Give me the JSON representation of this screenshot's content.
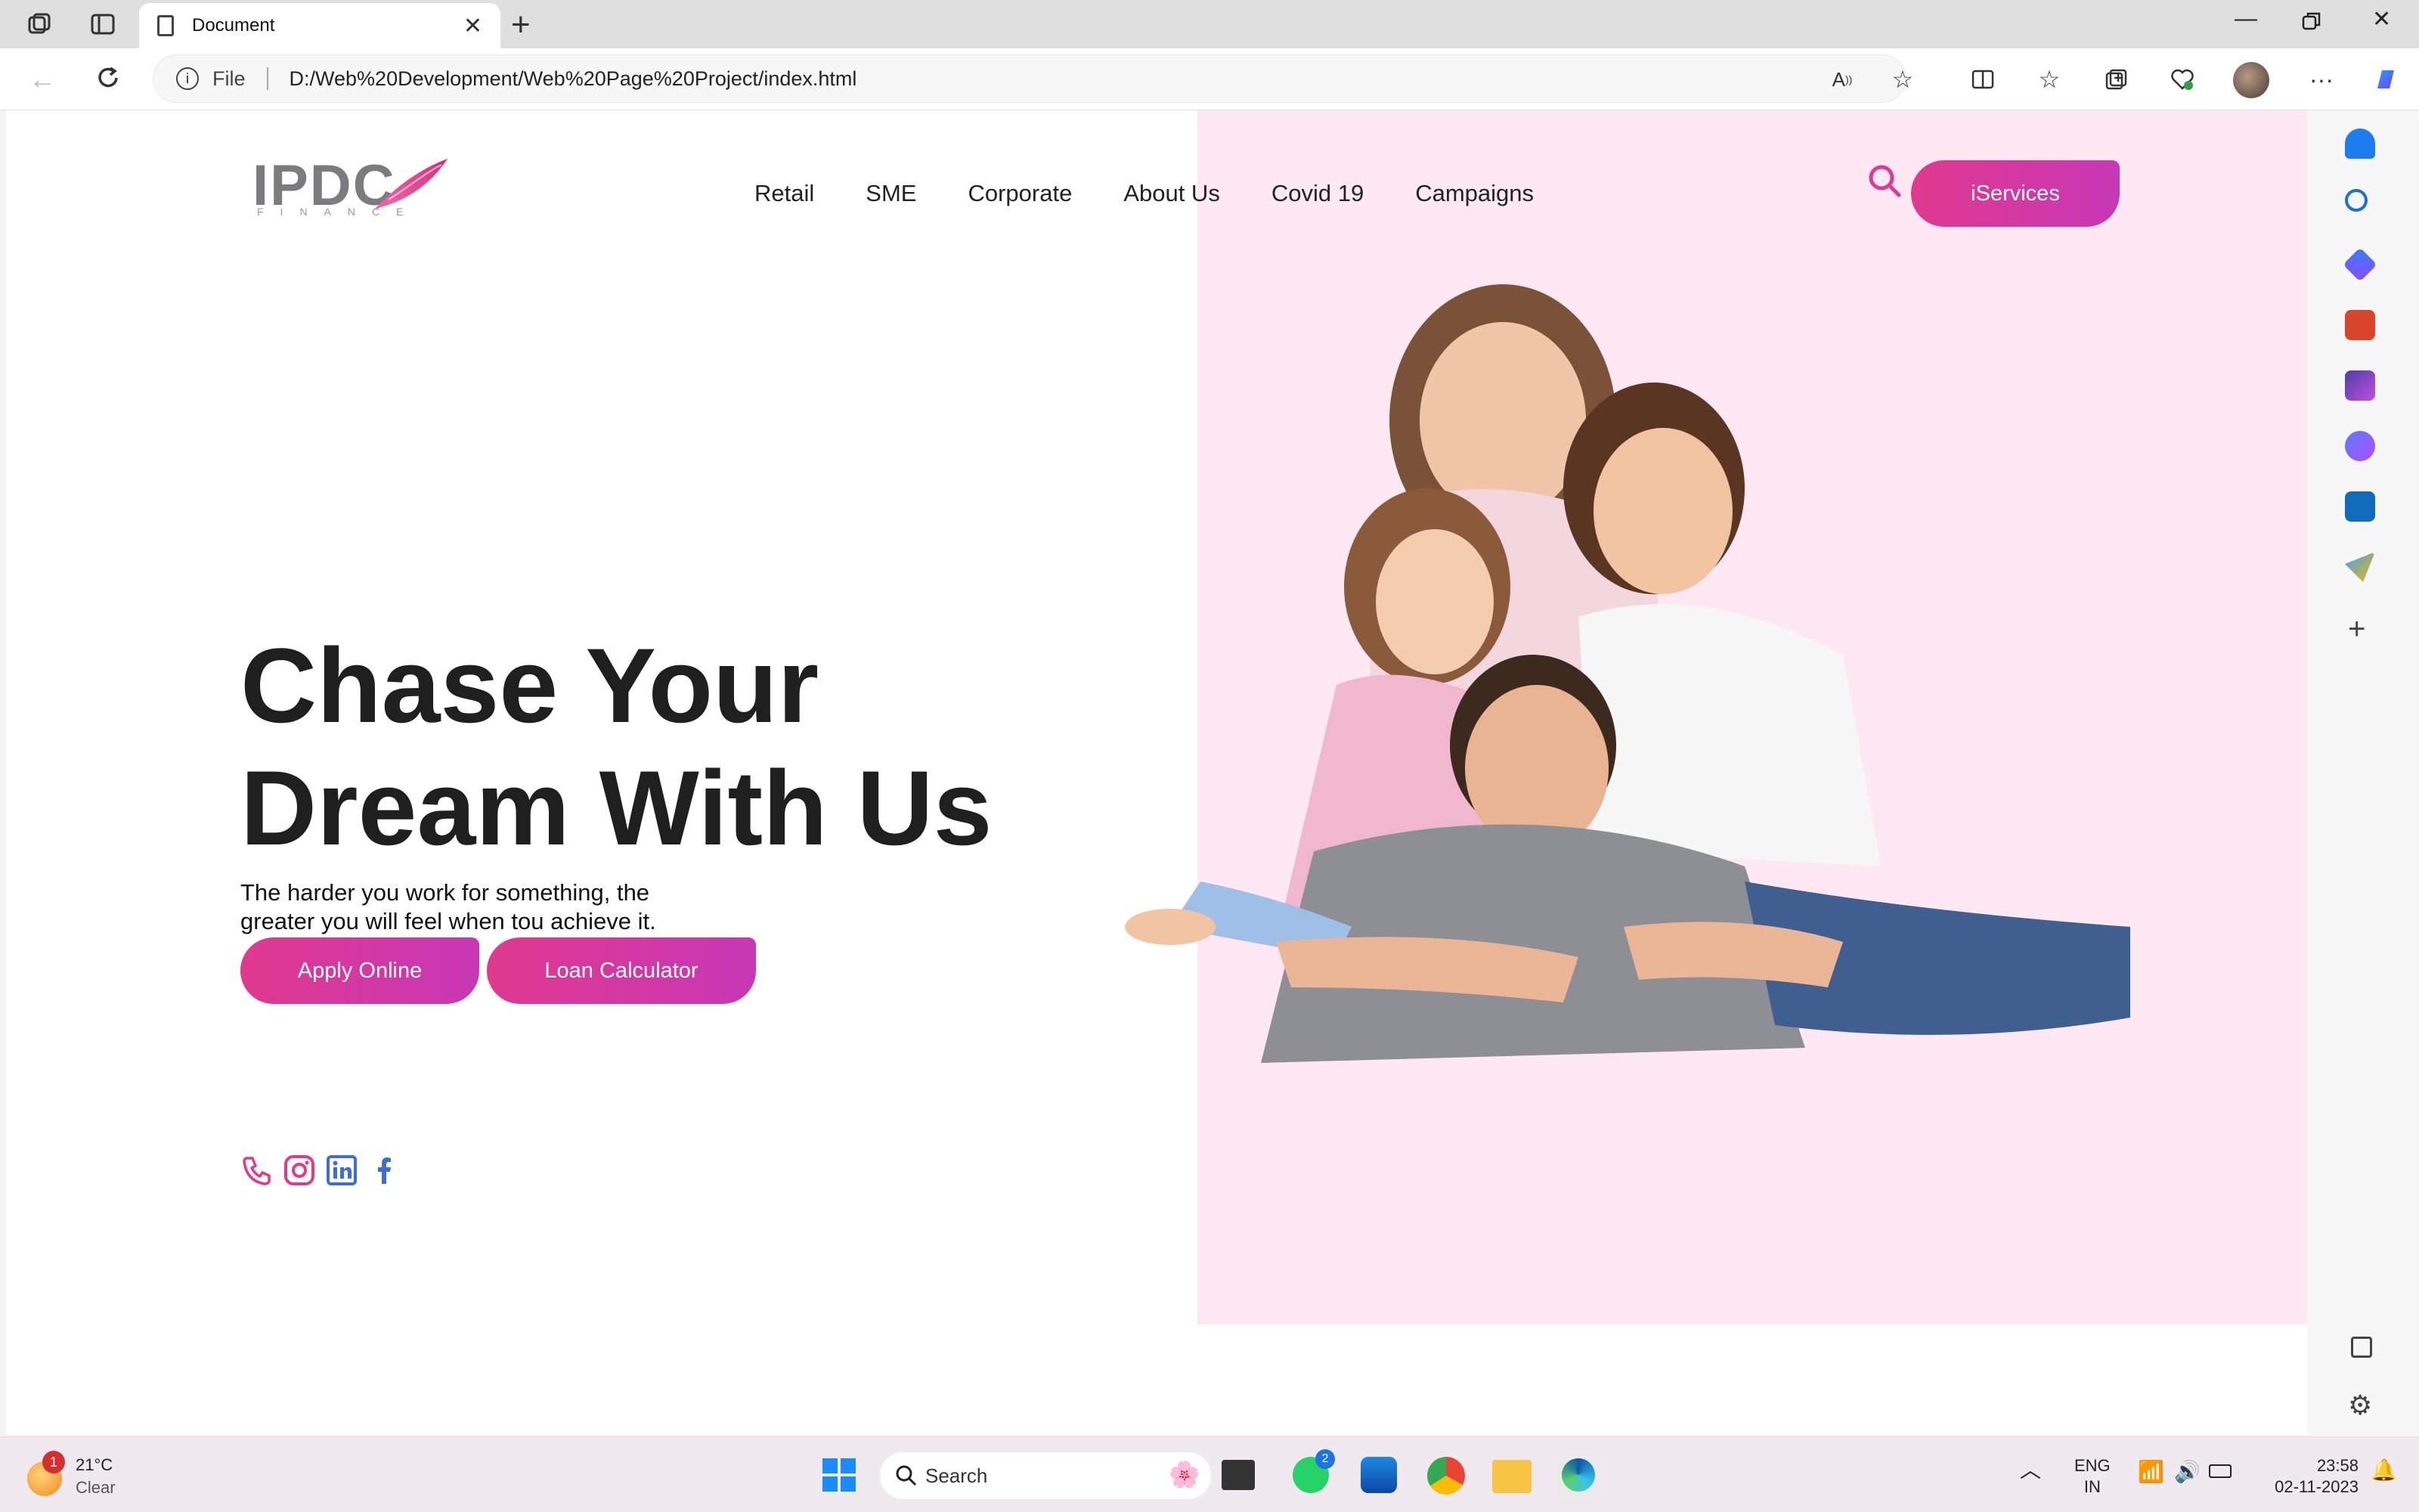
{
  "browser": {
    "tab_title": "Document",
    "url_prefix": "File",
    "url": "D:/Web%20Development/Web%20Page%20Project/index.html"
  },
  "site": {
    "logo_text": "IPDC",
    "logo_sub": "FINANCE",
    "nav": [
      "Retail",
      "SME",
      "Corporate",
      "About Us",
      "Covid 19",
      "Campaigns"
    ],
    "iservices_label": "iServices",
    "hero_line1": "Chase Your",
    "hero_line2": "Dream With Us",
    "hero_sub_line1": "The harder you work for something, the",
    "hero_sub_line2": "greater you will feel when tou achieve it.",
    "apply_label": "Apply Online",
    "loan_label": "Loan Calculator",
    "accent_color": "#e0398e",
    "accent_color_2": "#c737b6",
    "panel_color": "#fde8f3"
  },
  "taskbar": {
    "weather_temp": "21°C",
    "weather_desc": "Clear",
    "weather_badge": "1",
    "search_placeholder": "Search",
    "whatsapp_badge": "2",
    "lang_top": "ENG",
    "lang_bottom": "IN",
    "time": "23:58",
    "date": "02-11-2023"
  }
}
